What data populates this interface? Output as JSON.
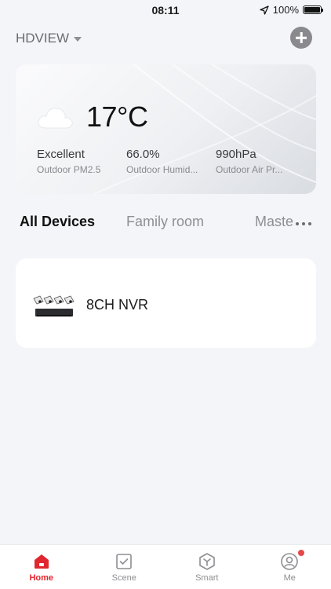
{
  "status_bar": {
    "time": "08:11",
    "battery": "100%"
  },
  "header": {
    "home_name": "HDVIEW"
  },
  "weather": {
    "temperature": "17°C",
    "metrics": [
      {
        "value": "Excellent",
        "label": "Outdoor PM2.5"
      },
      {
        "value": "66.0%",
        "label": "Outdoor Humid..."
      },
      {
        "value": "990hPa",
        "label": "Outdoor Air Pr..."
      }
    ]
  },
  "tabs": [
    "All Devices",
    "Family room",
    "Master"
  ],
  "devices": [
    {
      "name": "8CH NVR"
    }
  ],
  "nav": [
    {
      "label": "Home",
      "icon": "home-icon",
      "active": true
    },
    {
      "label": "Scene",
      "icon": "scene-icon",
      "active": false
    },
    {
      "label": "Smart",
      "icon": "smart-icon",
      "active": false
    },
    {
      "label": "Me",
      "icon": "profile-icon",
      "active": false,
      "badge": true
    }
  ],
  "colors": {
    "accent": "#e0262e",
    "badge": "#e74848",
    "background": "#f4f5f8"
  }
}
